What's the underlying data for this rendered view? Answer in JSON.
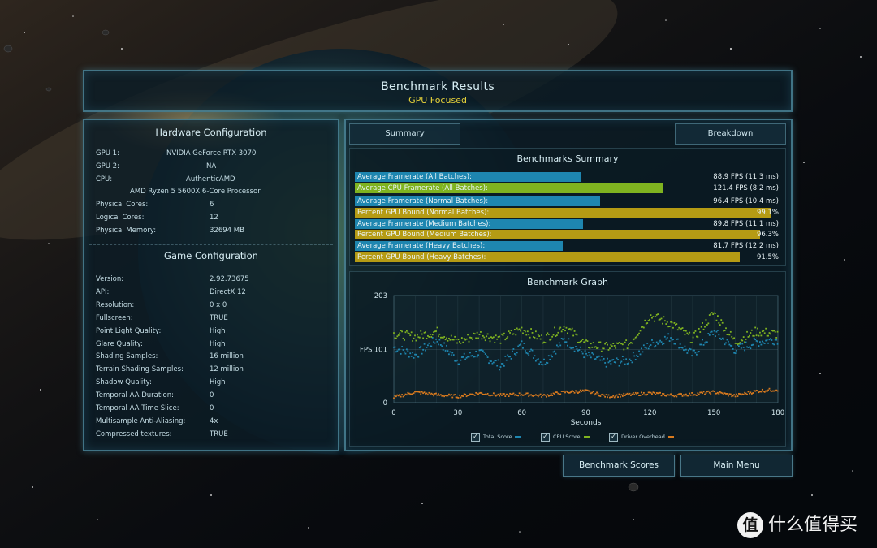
{
  "header": {
    "title": "Benchmark Results",
    "subtitle": "GPU Focused"
  },
  "hardware": {
    "title": "Hardware Configuration",
    "rows": [
      {
        "label": "GPU 1:",
        "value": "NVIDIA GeForce RTX 3070"
      },
      {
        "label": "GPU 2:",
        "value": "NA"
      },
      {
        "label": "CPU:",
        "value": "AuthenticAMD"
      },
      {
        "label": "",
        "value": "AMD Ryzen 5 5600X 6-Core Processor"
      },
      {
        "label": "Physical Cores:",
        "value": "6"
      },
      {
        "label": "Logical Cores:",
        "value": "12"
      },
      {
        "label": "Physical Memory:",
        "value": "32694  MB"
      }
    ]
  },
  "game": {
    "title": "Game Configuration",
    "rows": [
      {
        "label": "Version:",
        "value": "2.92.73675"
      },
      {
        "label": "API:",
        "value": "DirectX 12"
      },
      {
        "label": "Resolution:",
        "value": "0 x 0"
      },
      {
        "label": "Fullscreen:",
        "value": "TRUE"
      },
      {
        "label": "Point Light Quality:",
        "value": "High"
      },
      {
        "label": "Glare Quality:",
        "value": "High"
      },
      {
        "label": "Shading Samples:",
        "value": "16 million"
      },
      {
        "label": "Terrain Shading Samples:",
        "value": "12 million"
      },
      {
        "label": "Shadow Quality:",
        "value": "High"
      },
      {
        "label": "Temporal AA Duration:",
        "value": "0"
      },
      {
        "label": "Temporal AA Time Slice:",
        "value": "0"
      },
      {
        "label": "Multisample Anti-Aliasing:",
        "value": "4x"
      },
      {
        "label": "Compressed textures:",
        "value": "TRUE"
      }
    ]
  },
  "tabs": {
    "summary": "Summary",
    "breakdown": "Breakdown"
  },
  "summary": {
    "title": "Benchmarks Summary",
    "bars": [
      {
        "label": "Average Framerate (All Batches):",
        "value": "88.9 FPS (11.3 ms)",
        "fraction": 0.538,
        "color": "#1e86b0"
      },
      {
        "label": "Average CPU Framerate (All Batches):",
        "value": "121.4 FPS (8.2 ms)",
        "fraction": 0.734,
        "color": "#7fb320"
      },
      {
        "label": "Average Framerate (Normal Batches):",
        "value": "96.4 FPS (10.4 ms)",
        "fraction": 0.583,
        "color": "#1e86b0"
      },
      {
        "label": "Percent GPU Bound (Normal Batches):",
        "value": "99.1%",
        "fraction": 0.991,
        "color": "#b59b14"
      },
      {
        "label": "Average Framerate (Medium Batches):",
        "value": "89.8 FPS (11.1 ms)",
        "fraction": 0.543,
        "color": "#1e86b0"
      },
      {
        "label": "Percent GPU Bound (Medium Batches):",
        "value": "96.3%",
        "fraction": 0.963,
        "color": "#b59b14"
      },
      {
        "label": "Average Framerate (Heavy Batches):",
        "value": "81.7 FPS (12.2 ms)",
        "fraction": 0.494,
        "color": "#1e86b0"
      },
      {
        "label": "Percent GPU Bound (Heavy Batches):",
        "value": "91.5%",
        "fraction": 0.915,
        "color": "#b59b14"
      }
    ]
  },
  "graph": {
    "title": "Benchmark Graph"
  },
  "chart_data": {
    "type": "scatter",
    "title": "Benchmark Graph",
    "xlabel": "Seconds",
    "ylabel": "FPS",
    "xlim": [
      0,
      180
    ],
    "ylim": [
      0,
      203
    ],
    "x_ticks": [
      0,
      30,
      60,
      90,
      120,
      150,
      180
    ],
    "y_ticks": [
      0,
      101,
      203
    ],
    "grid": true,
    "legend_position": "bottom",
    "series": [
      {
        "name": "Total Score",
        "color": "#1e86b0",
        "x": [
          0,
          10,
          20,
          30,
          40,
          50,
          60,
          70,
          80,
          90,
          100,
          110,
          120,
          130,
          140,
          150,
          160,
          170,
          180
        ],
        "y": [
          105,
          90,
          120,
          80,
          95,
          70,
          110,
          75,
          120,
          90,
          75,
          80,
          110,
          125,
          90,
          135,
          100,
          115,
          120
        ]
      },
      {
        "name": "CPU Score",
        "color": "#7fb320",
        "x": [
          0,
          10,
          20,
          30,
          40,
          50,
          60,
          70,
          80,
          90,
          100,
          110,
          120,
          130,
          140,
          150,
          160,
          170,
          180
        ],
        "y": [
          130,
          125,
          135,
          115,
          130,
          120,
          140,
          120,
          145,
          110,
          105,
          110,
          165,
          150,
          120,
          170,
          115,
          135,
          130
        ]
      },
      {
        "name": "Driver Overhead",
        "color": "#d97a1e",
        "x": [
          0,
          10,
          20,
          30,
          40,
          50,
          60,
          70,
          80,
          90,
          100,
          110,
          120,
          130,
          140,
          150,
          160,
          170,
          180
        ],
        "y": [
          10,
          20,
          15,
          12,
          18,
          14,
          16,
          13,
          20,
          22,
          12,
          15,
          18,
          14,
          16,
          20,
          13,
          22,
          25
        ]
      }
    ]
  },
  "buttons": {
    "scores": "Benchmark Scores",
    "menu": "Main Menu"
  },
  "watermark": {
    "logo": "值",
    "text": "什么值得买"
  }
}
